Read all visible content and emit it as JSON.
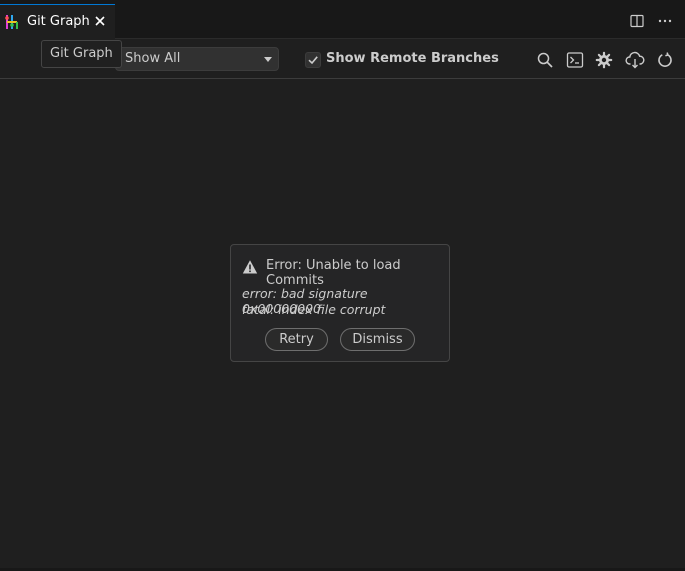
{
  "tab": {
    "title": "Git Graph",
    "close_icon": "close-icon",
    "icon": "git-graph-icon"
  },
  "tooltip": {
    "text": "Git Graph"
  },
  "toolbar": {
    "branches_select": "Show All",
    "show_remote_branches": {
      "label": "Show Remote Branches",
      "checked": true
    },
    "tools": [
      "search-icon",
      "terminal-icon",
      "gear-icon",
      "cloud-download-icon",
      "refresh-icon"
    ]
  },
  "editor_actions": [
    "split-editor-icon",
    "more-icon"
  ],
  "dialog": {
    "title": "Error: Unable to load Commits",
    "lines": [
      "error: bad signature 0x00000000",
      "fatal: index file corrupt"
    ],
    "buttons": {
      "retry": "Retry",
      "dismiss": "Dismiss"
    }
  },
  "colors": {
    "accent": "#0078d4",
    "background": "#1f1f1f"
  }
}
